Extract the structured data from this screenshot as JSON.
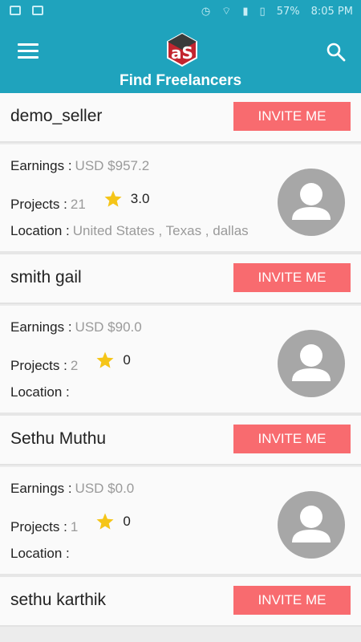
{
  "status_bar": {
    "battery": "57%",
    "time": "8:05 PM"
  },
  "app_bar": {
    "title": "Find Freelancers"
  },
  "labels": {
    "earnings": "Earnings :",
    "projects": "Projects :",
    "location": "Location :",
    "invite": "INVITE ME"
  },
  "freelancers": [
    {
      "name": "demo_seller",
      "earnings": "USD $957.2",
      "projects": "21",
      "rating": "3.0",
      "location": "United States , Texas , dallas"
    },
    {
      "name": "smith gail",
      "earnings": "USD $90.0",
      "projects": "2",
      "rating": "0",
      "location": ""
    },
    {
      "name": "Sethu Muthu",
      "earnings": "USD $0.0",
      "projects": "1",
      "rating": "0",
      "location": ""
    },
    {
      "name": "sethu karthik"
    }
  ],
  "colors": {
    "primary": "#1fa3bd",
    "invite": "#f86b6f",
    "star": "#f5c518",
    "avatar": "#a7a7a7"
  }
}
